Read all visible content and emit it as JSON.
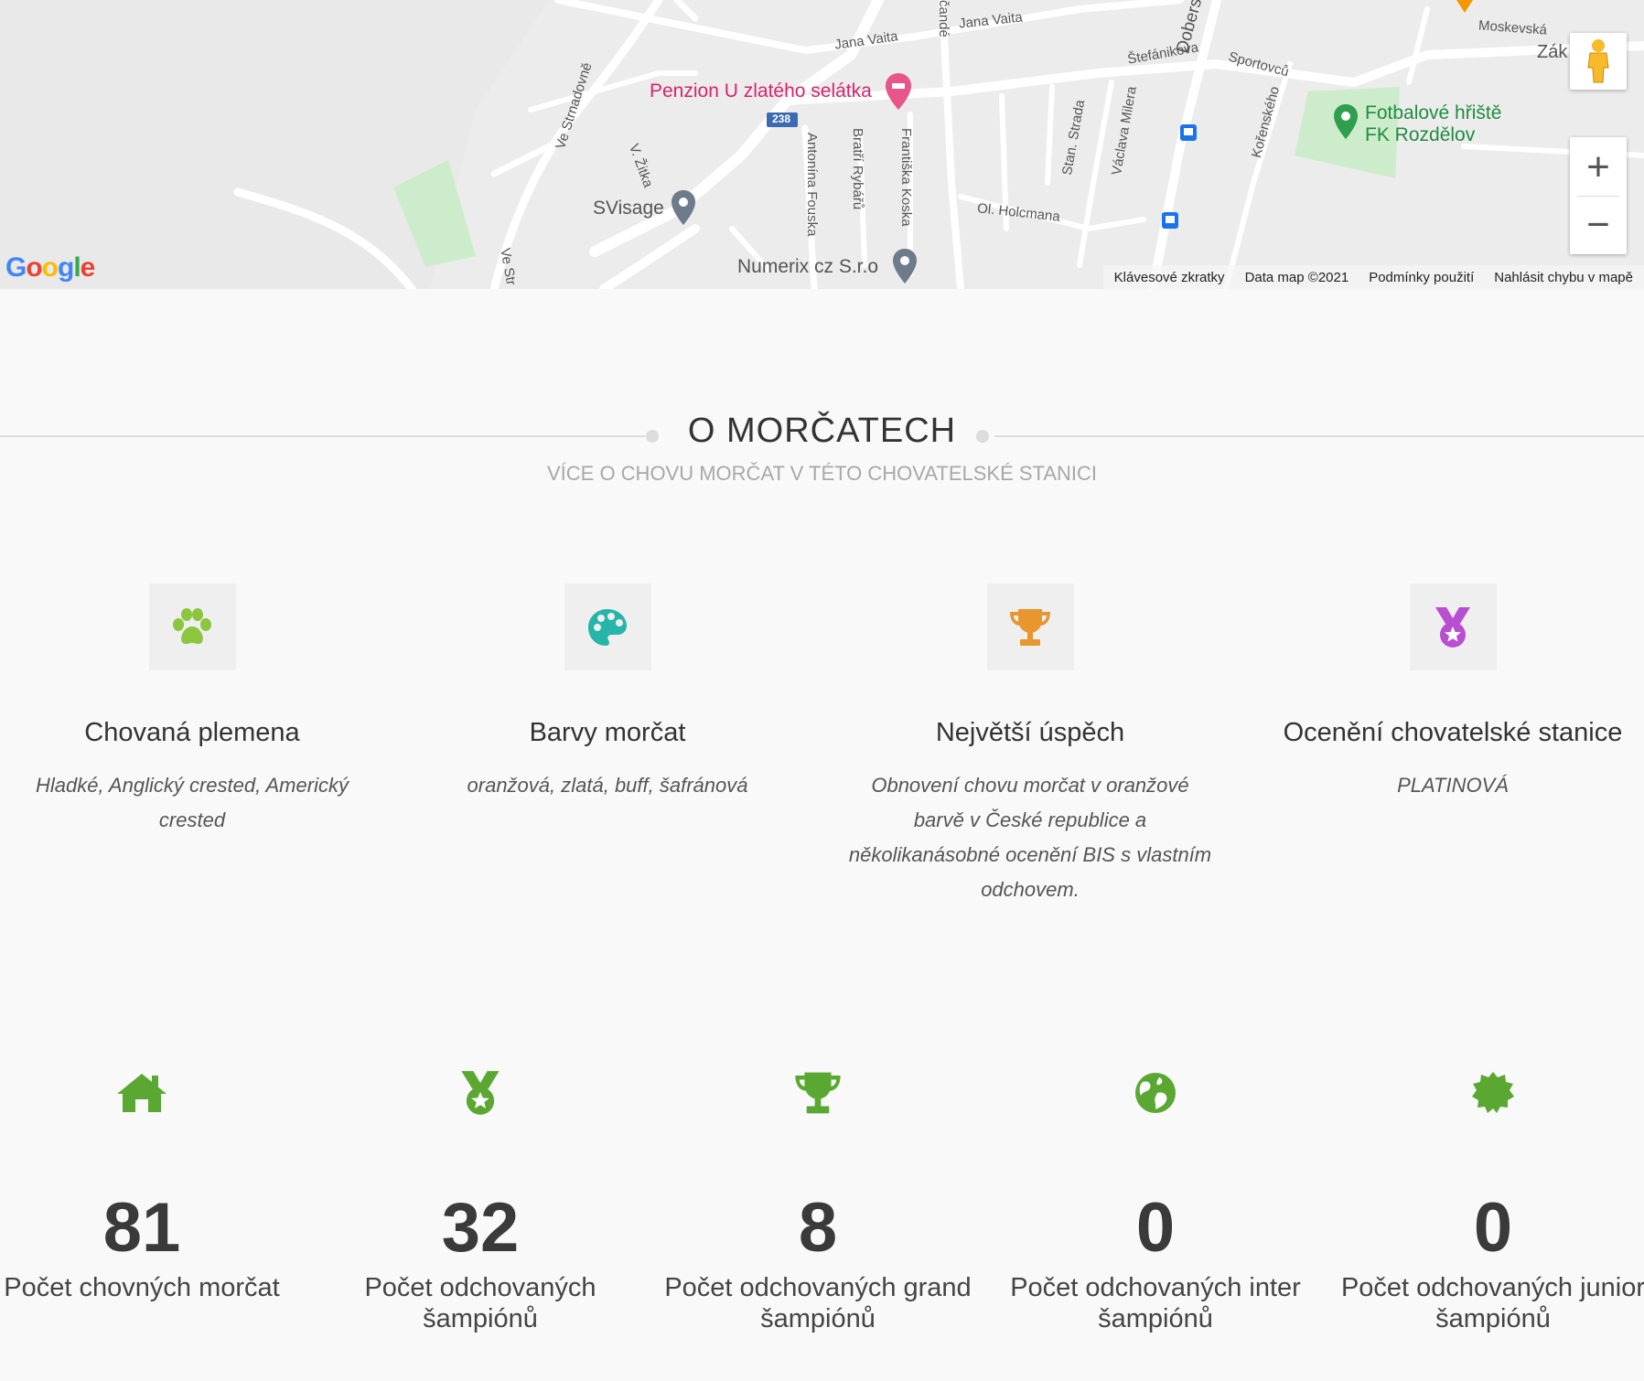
{
  "map": {
    "streets": {
      "jana_vaita_1": "Jana Vaita",
      "jana_vaita_2": "Jana Vaita",
      "stefanikova": "Štefánikova",
      "sportovcu": "Sportovců",
      "moskevska": "Moskevská",
      "zak": "Zák",
      "doberska": "Doberská",
      "korenskeho": "Kořenského",
      "stan_strada": "Stan. Strada",
      "vaclava_milera": "Václava Milera",
      "frantiska_koska": "Františka Koska",
      "bratri_rybaru": "Bratří Rybářů",
      "antonina_fouska": "Antonína Fouska",
      "ol_holcmana": "Ol. Holcmana",
      "ve_strnadovne": "Ve Strnadovně",
      "ve_str": "Ve Str",
      "v_zitka": "V. Žitka",
      "cande": "čandé"
    },
    "road_shield": "238",
    "pois": {
      "penzion": "Penzion U zlatého selátka",
      "svisage": "SVisage",
      "numerix": "Numerix cz S.r.o",
      "football_line1": "Fotbalové hřiště",
      "football_line2": "FK Rozdělov"
    },
    "controls": {
      "zoom_in": "+",
      "zoom_out": "−"
    },
    "attribution": {
      "shortcuts": "Klávesové zkratky",
      "data": "Data map ©2021",
      "terms": "Podmínky použití",
      "report": "Nahlásit chybu v mapě"
    },
    "logo": {
      "g1": "G",
      "o1": "o",
      "o2": "o",
      "g2": "g",
      "l": "l",
      "e": "e"
    }
  },
  "section": {
    "title": "O MORČATECH",
    "subtitle": "VÍCE O CHOVU MORČAT V TÉTO CHOVATELSKÉ STANICI"
  },
  "features": [
    {
      "icon": "paw-icon",
      "color": "#8cc63f",
      "title": "Chovaná plemena",
      "text": "Hladké, Anglický crested, Americký crested"
    },
    {
      "icon": "palette-icon",
      "color": "#26b5a8",
      "title": "Barvy morčat",
      "text": "oranžová, zlatá, buff, šafránová"
    },
    {
      "icon": "trophy-icon",
      "color": "#e8962e",
      "title": "Největší úspěch",
      "text": "Obnovení chovu morčat v oranžové barvě v České republice a několikanásobné ocenění BIS s vlastním odchovem."
    },
    {
      "icon": "medal-icon",
      "color": "#b84fd1",
      "title": "Ocenění chovatelské stanice",
      "text": "PLATINOVÁ"
    }
  ],
  "stats": [
    {
      "icon": "home-icon",
      "value": "81",
      "label": "Počet chovných morčat"
    },
    {
      "icon": "medal-icon",
      "value": "32",
      "label": "Počet odchovaných šampiónů"
    },
    {
      "icon": "trophy-icon",
      "value": "8",
      "label": "Počet odchovaných grand šampiónů"
    },
    {
      "icon": "globe-icon",
      "value": "0",
      "label": "Počet odchovaných inter šampiónů"
    },
    {
      "icon": "certificate-icon",
      "value": "0",
      "label": "Počet odchovaných junior šampiónů"
    }
  ],
  "colors": {
    "stat_green": "#5aa832",
    "poi_pink": "#d6246e",
    "poi_green": "#1e8e3e"
  }
}
